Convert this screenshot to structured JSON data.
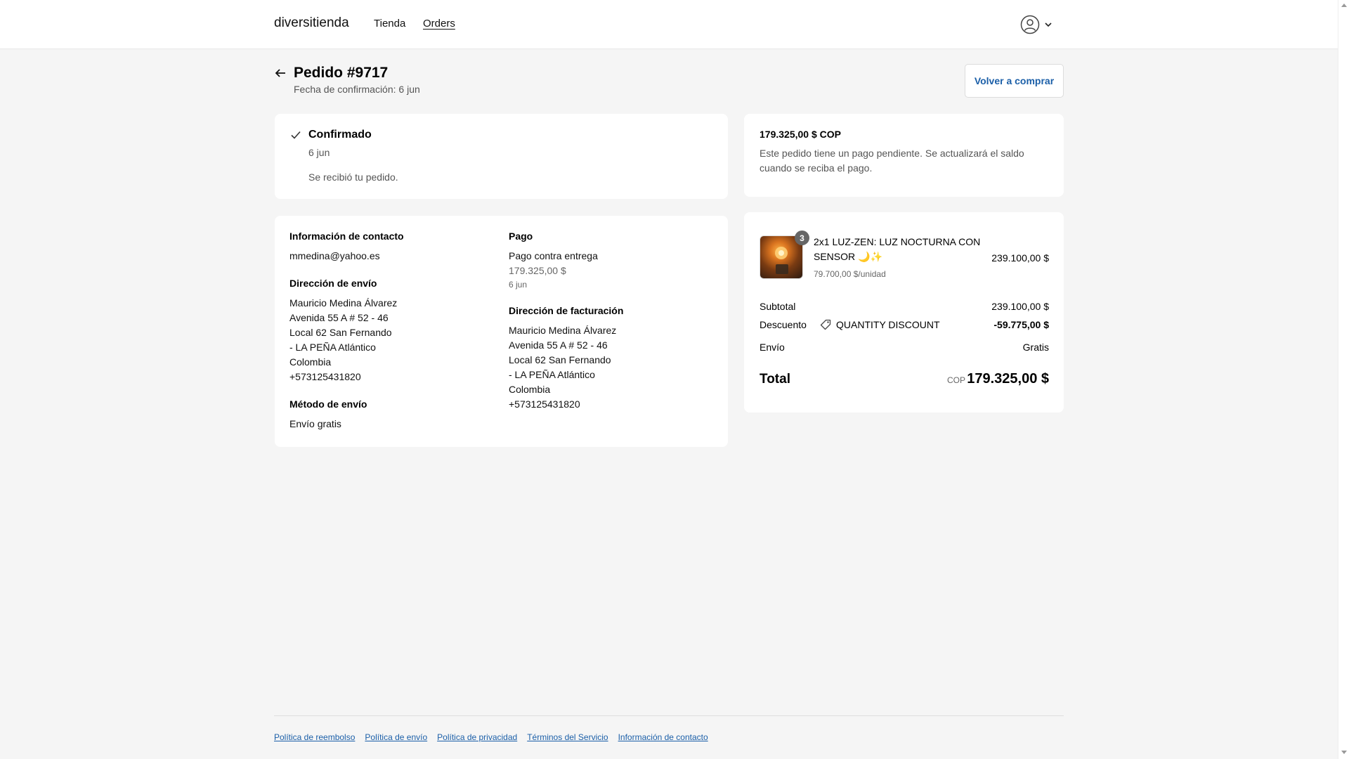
{
  "header": {
    "brand": "diversitienda",
    "nav": [
      {
        "label": "Tienda"
      },
      {
        "label": "Orders"
      }
    ],
    "account_icon": "user-circle-icon"
  },
  "order": {
    "title": "Pedido #9717",
    "confirmed_label": "Fecha de confirmación: 6 jun",
    "buy_again": "Volver a comprar"
  },
  "status": {
    "title": "Confirmado",
    "date": "6 jun",
    "message": "Se recibió tu pedido."
  },
  "pending": {
    "amount": "179.325,00 $ COP",
    "message": "Este pedido tiene un pago pendiente. Se actualizará el saldo cuando se reciba el pago."
  },
  "details": {
    "contact": {
      "heading": "Información de contacto",
      "email": "mmedina@yahoo.es"
    },
    "shipping_address": {
      "heading": "Dirección de envío",
      "lines": [
        "Mauricio Medina Álvarez",
        "Avenida 55 A # 52 - 46",
        "Local 62 San Fernando",
        "- LA PEÑA Atlántico",
        "Colombia",
        "+573125431820"
      ]
    },
    "shipping_method": {
      "heading": "Método de envío",
      "value": "Envío gratis"
    },
    "payment": {
      "heading": "Pago",
      "method": "Pago contra entrega",
      "amount": "179.325,00 $",
      "date": "6 jun"
    },
    "billing_address": {
      "heading": "Dirección de facturación",
      "lines": [
        "Mauricio Medina Álvarez",
        "Avenida 55 A # 52 - 46",
        "Local 62 San Fernando",
        "- LA PEÑA Atlántico",
        "Colombia",
        "+573125431820"
      ]
    }
  },
  "summary": {
    "item": {
      "quantity": "3",
      "name": "2x1 LUZ-ZEN: LUZ NOCTURNA CON SENSOR 🌙✨",
      "unit_price": "79.700,00 $/unidad",
      "price": "239.100,00 $"
    },
    "subtotal_label": "Subtotal",
    "subtotal": "239.100,00 $",
    "discount_label": "Descuento",
    "discount_code": "QUANTITY DISCOUNT",
    "discount": "-59.775,00 $",
    "shipping_label": "Envío",
    "shipping": "Gratis",
    "total_label": "Total",
    "total_currency": "COP",
    "total": "179.325,00 $"
  },
  "footer": {
    "links": [
      "Política de reembolso",
      "Política de envío",
      "Política de privacidad",
      "Términos del Servicio",
      "Información de contacto"
    ]
  },
  "colors": {
    "accent": "#1b5fa8",
    "background": "#f5f5f5"
  }
}
